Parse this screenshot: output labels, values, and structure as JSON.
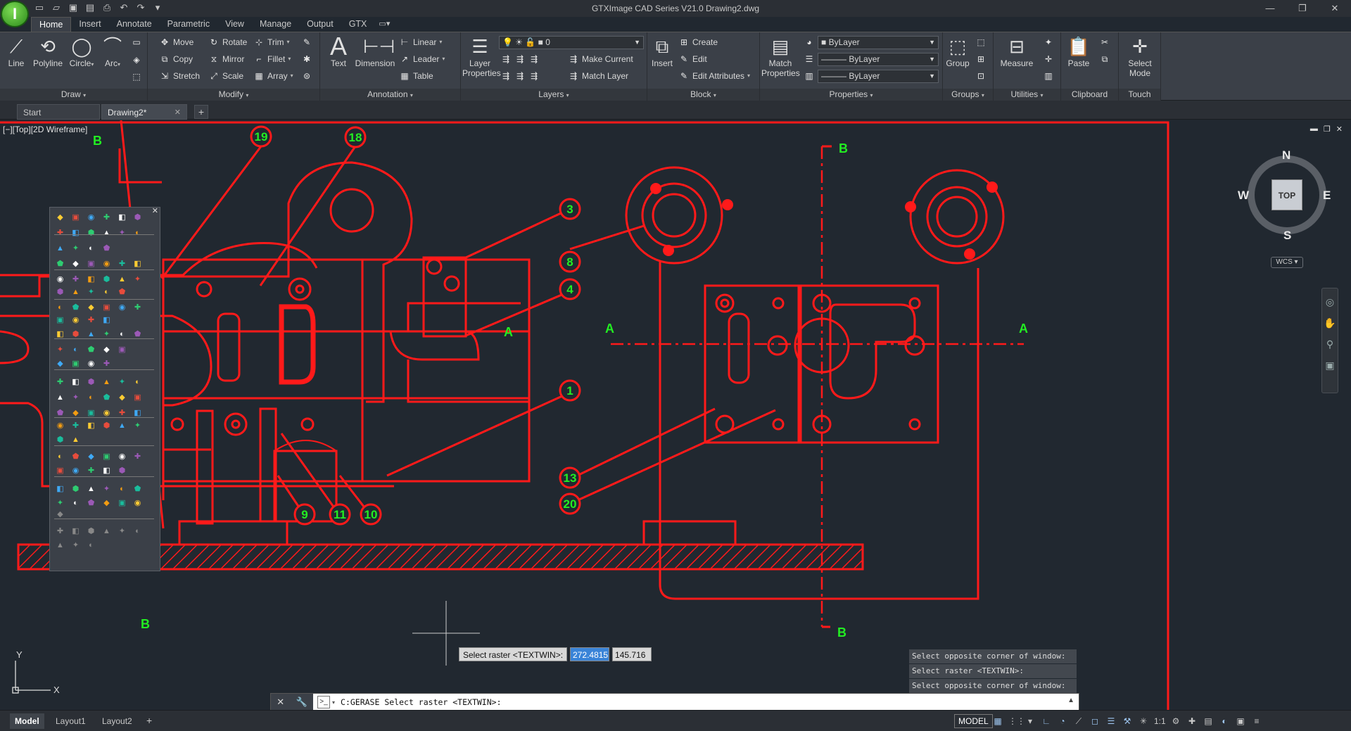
{
  "app": {
    "title": "GTXImage CAD Series V21.0    Drawing2.dwg",
    "logo_letter": "I",
    "brand_color": "#4cbb2c"
  },
  "quick_access": [
    "new-icon",
    "open-icon",
    "save-icon",
    "saveas-icon",
    "print-icon",
    "undo-icon",
    "redo-icon",
    "more-icon"
  ],
  "window_controls": {
    "minimize": "—",
    "restore": "❐",
    "close": "✕"
  },
  "ribbon_tabs": [
    "Home",
    "Insert",
    "Annotate",
    "Parametric",
    "View",
    "Manage",
    "Output",
    "GTX"
  ],
  "active_tab": "Home",
  "panels": {
    "draw": {
      "title": "Draw",
      "buttons": [
        "Line",
        "Polyline",
        "Circle",
        "Arc"
      ]
    },
    "modify": {
      "title": "Modify",
      "items": [
        "Move",
        "Rotate",
        "Trim",
        "Copy",
        "Mirror",
        "Fillet",
        "Stretch",
        "Scale",
        "Array"
      ]
    },
    "annotation": {
      "title": "Annotation",
      "text": "Text",
      "dimension": "Dimension",
      "items": [
        "Linear",
        "Leader",
        "Table"
      ]
    },
    "layers": {
      "title": "Layers",
      "layer_properties": "Layer Properties",
      "current_layer": "0",
      "items": [
        "Make Current",
        "Match Layer"
      ]
    },
    "block": {
      "title": "Block",
      "insert": "Insert",
      "items": [
        "Create",
        "Edit",
        "Edit Attributes"
      ]
    },
    "properties": {
      "title": "Properties",
      "match": "Match Properties",
      "color": "ByLayer",
      "linetype": "ByLayer",
      "lineweight": "ByLayer"
    },
    "groups": {
      "title": "Groups",
      "group": "Group"
    },
    "utilities": {
      "title": "Utilities",
      "measure": "Measure"
    },
    "clipboard": {
      "title": "Clipboard",
      "paste": "Paste"
    },
    "touch": {
      "title": "Touch",
      "select_mode": "Select Mode"
    }
  },
  "file_tabs": [
    {
      "label": "Start",
      "active": false
    },
    {
      "label": "Drawing2*",
      "active": true
    }
  ],
  "viewport": {
    "label": "[−][Top][2D Wireframe]",
    "drawing_color": "#ff1a1a",
    "balloon_color": "#22ee22",
    "balloons": [
      "19",
      "18",
      "3",
      "8",
      "4",
      "1",
      "9",
      "11",
      "10",
      "13",
      "20"
    ],
    "section_marks": [
      "B",
      "B",
      "B",
      "B",
      "A",
      "A",
      "A"
    ]
  },
  "viewcube": {
    "top": "TOP",
    "north": "N",
    "south": "S",
    "east": "E",
    "west": "W",
    "wcs": "WCS"
  },
  "ucs": {
    "y": "Y",
    "x": "X"
  },
  "dynamic_input": {
    "prompt": "Select raster <TEXTWIN>:",
    "x": "272.4815",
    "y": "145.716"
  },
  "command_history": [
    "Select opposite corner of window:",
    "Select raster <TEXTWIN>:",
    "Select opposite corner of window:"
  ],
  "command_line": {
    "text": "C:GERASE Select raster <TEXTWIN>:"
  },
  "layout_tabs": [
    {
      "label": "Model",
      "active": true
    },
    {
      "label": "Layout1",
      "active": false
    },
    {
      "label": "Layout2",
      "active": false
    }
  ],
  "status": {
    "model": "MODEL",
    "scale": "1:1"
  }
}
